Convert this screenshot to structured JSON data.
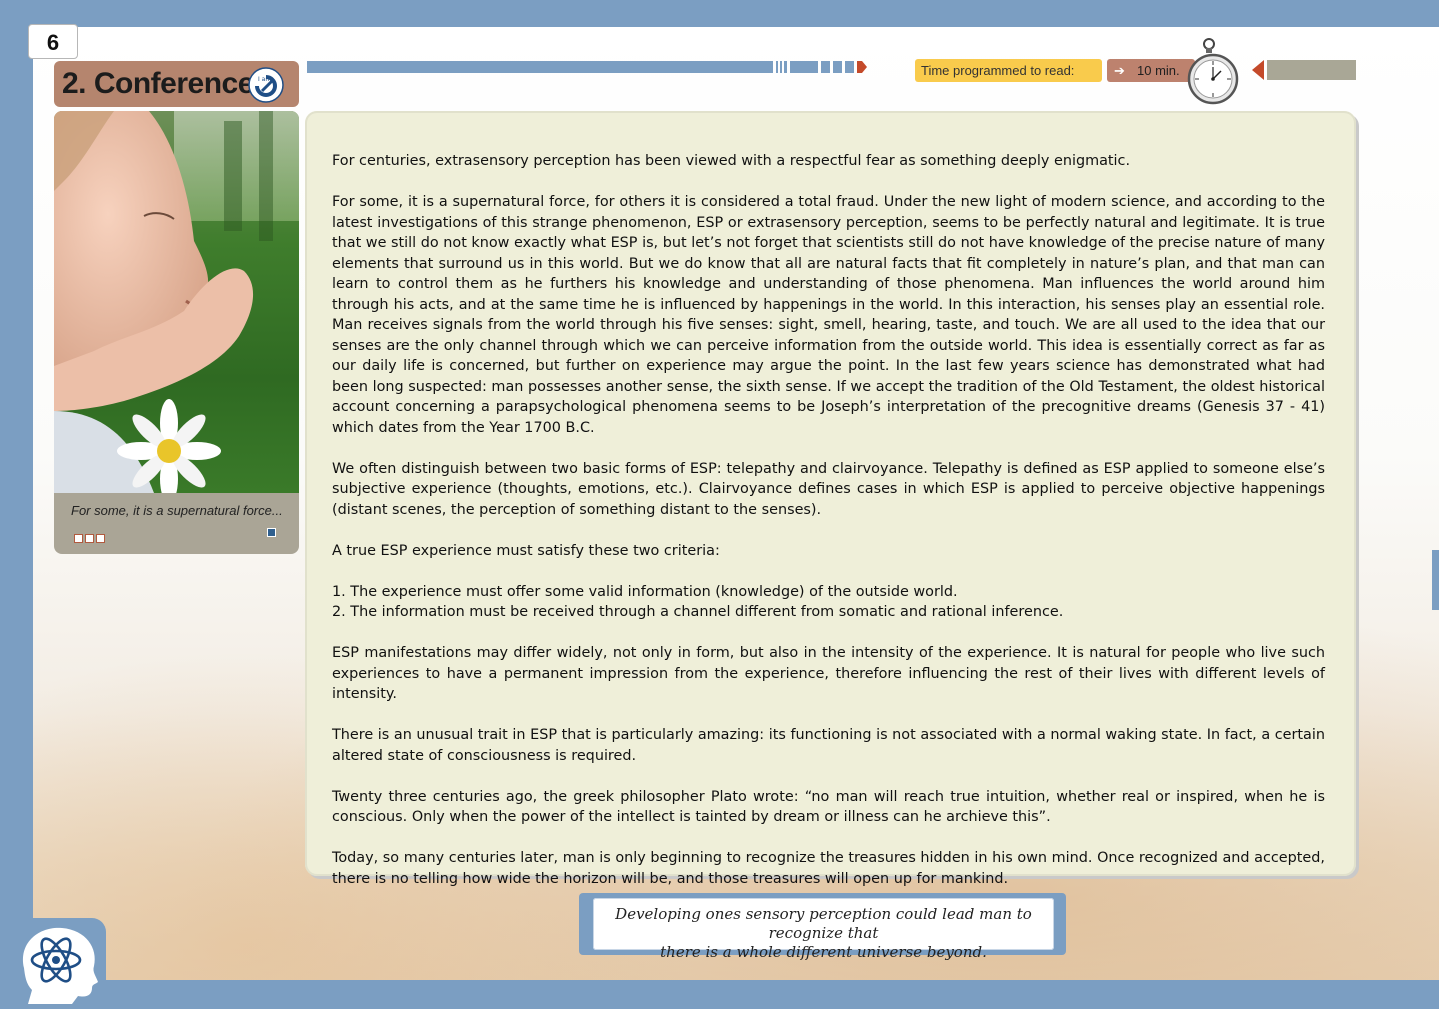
{
  "page": {
    "number": "6"
  },
  "header": {
    "title": "2. Conference",
    "title_icon": "i-am-logo-icon",
    "title_icon_text": "I am",
    "timer_label": "Time programmed to read:",
    "timer_value": "10 min."
  },
  "photo_card": {
    "caption": "For some, it is a supernatural force...",
    "image": "child-with-daisy-photo"
  },
  "body": {
    "paragraphs": [
      "For centuries, extrasensory perception has been viewed with a respectful fear as something deeply enigmatic.",
      "For some, it is a supernatural force, for others it is considered a total fraud. Under the new light of modern science, and according to the latest investigations of this strange phenomenon, ESP or extrasensory perception, seems to be perfectly natural and legitimate. It is true that we still do not know exactly what ESP is, but let’s not forget that scientists still do not have knowledge of the precise nature of many elements that surround us in this world. But we do know that all are natural facts that fit completely in nature’s plan, and that man can learn to control them as he furthers his knowledge and understanding of those phenomena. Man influences the world around him through his acts, and at the same time he is influenced by happenings in the world. In this interaction, his senses play an essential role. Man receives signals from the world through his five senses: sight, smell, hearing, taste, and touch. We are all used to the idea that our senses are the only channel through which we can perceive information from the outside world. This idea is essentially correct as far as our daily life is concerned, but further on experience may argue the point. In the last few years science has demonstrated what had been long suspected: man possesses another sense, the sixth sense. If we accept the tradition of the Old Testament, the oldest historical account concerning a parapsychological phenomena seems to be Joseph’s interpretation of the precognitive dreams (Genesis 37 - 41) which dates from the Year 1700 B.C.",
      "We often distinguish between two basic forms of ESP: telepathy and clairvoyance. Telepathy is defined as ESP applied to someone else’s subjective experience (thoughts, emotions, etc.). Clairvoyance defines  cases in which ESP is applied to perceive objective happenings (distant scenes, the perception of something distant to the senses).",
      "A true ESP experience must satisfy these two criteria:"
    ],
    "criteria": [
      "1. The experience must offer some valid information (knowledge) of the outside world.",
      "2. The information must be received through a channel different from somatic and rational inference."
    ],
    "paragraphs_after": [
      "ESP manifestations may differ widely, not only in form, but also in the intensity of the experience. It is natural for people who live such experiences to have a  permanent impression from the experience, therefore influencing the rest of  their lives with different levels of intensity.",
      "There is an unusual trait in ESP that is particularly amazing: its functioning is not associated with a normal waking state. In fact, a certain altered state of consciousness is required.",
      "Twenty three centuries ago, the greek philosopher Plato wrote: “no man will reach true intuition, whether real or inspired, when he is conscious. Only when the power of the intellect is tainted by dream or illness can he archieve this”.",
      "Today, so many centuries later, man is only beginning to recognize the treasures hidden in his own mind. Once recognized and accepted, there is no telling how wide the horizon will be, and those treasures will open up for mankind."
    ]
  },
  "quote": {
    "line1": "Developing ones sensory perception could lead man to recognize that",
    "line2": "there is a whole different universe beyond."
  },
  "footer": {
    "logo": "atom-head-logo-icon"
  },
  "colors": {
    "frame": "#7b9ec2",
    "title_bg": "#b5856e",
    "timer_label_bg": "#f9cb4c",
    "timer_value_bg": "#bd826e",
    "panel_bg": "#efefd9",
    "accent_dark_blue": "#1f4e86"
  }
}
